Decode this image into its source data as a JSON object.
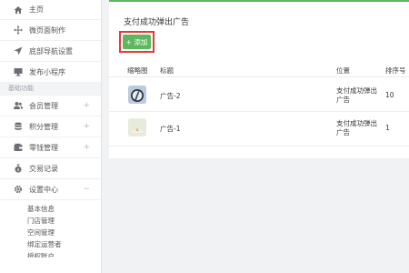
{
  "sidebar": {
    "items": [
      {
        "label": "主页",
        "icon": "home-icon"
      },
      {
        "label": "微页面制作",
        "icon": "move-icon"
      },
      {
        "label": "底部导航设置",
        "icon": "navigation-arrow-icon"
      },
      {
        "label": "发布小程序",
        "icon": "monitor-icon"
      }
    ],
    "section_label": "基础功能",
    "groups": [
      {
        "label": "会员管理",
        "icon": "users-icon",
        "expander": "+"
      },
      {
        "label": "积分管理",
        "icon": "database-icon",
        "expander": "+"
      },
      {
        "label": "零钱管理",
        "icon": "wallet-icon",
        "expander": "+"
      },
      {
        "label": "交易记录",
        "icon": "money-bag-icon"
      },
      {
        "label": "设置中心",
        "icon": "gear-icon",
        "expander": "−"
      }
    ],
    "sub_items": [
      "基本信息",
      "门店管理",
      "空间管理",
      "绑定运营者",
      "授权账户"
    ]
  },
  "main": {
    "title": "支付成功弹出广告",
    "add_button_label": "+ 添加",
    "columns": [
      "缩略图",
      "标题",
      "位置",
      "排序号"
    ],
    "rows": [
      {
        "title": "广告-2",
        "position_line1": "支付成功弹出",
        "position_line2": "广告",
        "sort": "10"
      },
      {
        "title": "广告-1",
        "position_line1": "支付成功弹出",
        "position_line2": "广告",
        "sort": "1"
      }
    ]
  },
  "colors": {
    "accent_green": "#5cb85c",
    "highlight_red": "#e53a3a"
  }
}
